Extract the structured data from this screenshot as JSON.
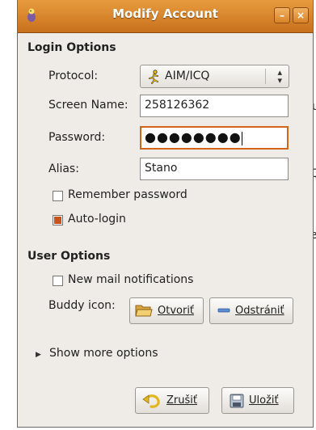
{
  "background_fragments": [
    "u",
    "Q,",
    "e"
  ],
  "window": {
    "title": "Modify Account",
    "minimize_symbol": "–",
    "close_symbol": "×"
  },
  "login_options": {
    "heading": "Login Options",
    "protocol_label": "Protocol:",
    "protocol_value": "AIM/ICQ",
    "screen_name_label": "Screen Name:",
    "screen_name_value": "258126362",
    "password_label": "Password:",
    "password_mask": "●●●●●●●●",
    "alias_label": "Alias:",
    "alias_value": "Stano",
    "remember_password_label": "Remember password",
    "remember_password_checked": false,
    "auto_login_label": "Auto-login",
    "auto_login_checked": true
  },
  "user_options": {
    "heading": "User Options",
    "new_mail_label": "New mail notifications",
    "new_mail_checked": false,
    "buddy_icon_label": "Buddy icon:",
    "open_button": "Otvoriť",
    "remove_button": "Odstrániť"
  },
  "expander": {
    "label": "Show more options",
    "arrow": "▶"
  },
  "actions": {
    "cancel_button": "Zrušiť",
    "save_button": "Uložiť"
  },
  "colors": {
    "titlebar": "#d98328",
    "window_bg": "#efebe6",
    "focus_border": "#d2661c",
    "check_fill": "#c9531a"
  }
}
